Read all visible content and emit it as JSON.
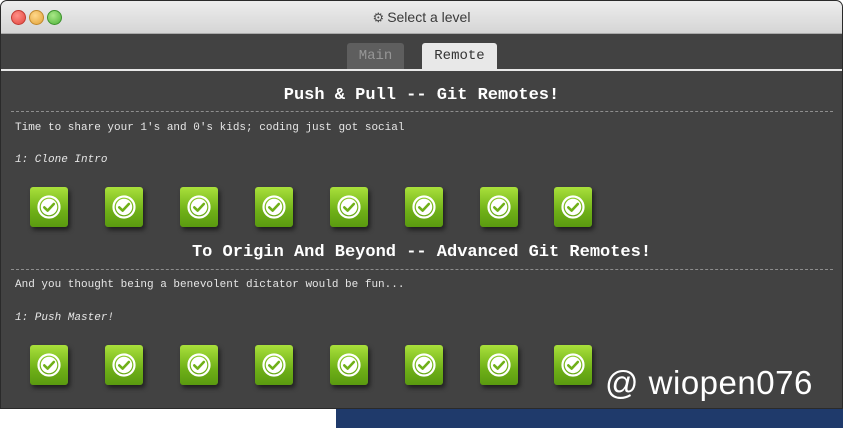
{
  "window": {
    "title": "Select a level",
    "title_icon": "gear-icon"
  },
  "tabs": [
    {
      "label": "Main",
      "active": false
    },
    {
      "label": "Remote",
      "active": true
    }
  ],
  "sections": [
    {
      "title": "Push & Pull -- Git Remotes!",
      "description": "Time to share your 1's and 0's kids; coding just got social",
      "sequence_label": "1: Clone Intro",
      "levels": [
        {
          "status": "completed",
          "icon": "checkmark-icon"
        },
        {
          "status": "completed",
          "icon": "checkmark-icon"
        },
        {
          "status": "completed",
          "icon": "checkmark-icon"
        },
        {
          "status": "completed",
          "icon": "checkmark-icon"
        },
        {
          "status": "completed",
          "icon": "checkmark-icon"
        },
        {
          "status": "completed",
          "icon": "checkmark-icon"
        },
        {
          "status": "completed",
          "icon": "checkmark-icon"
        },
        {
          "status": "completed",
          "icon": "checkmark-icon"
        }
      ]
    },
    {
      "title": "To Origin And Beyond -- Advanced Git Remotes!",
      "description": "And you thought being a benevolent dictator would be fun...",
      "sequence_label": "1: Push Master!",
      "levels": [
        {
          "status": "completed",
          "icon": "checkmark-icon"
        },
        {
          "status": "completed",
          "icon": "checkmark-icon"
        },
        {
          "status": "completed",
          "icon": "checkmark-icon"
        },
        {
          "status": "completed",
          "icon": "checkmark-icon"
        },
        {
          "status": "completed",
          "icon": "checkmark-icon"
        },
        {
          "status": "completed",
          "icon": "checkmark-icon"
        },
        {
          "status": "completed",
          "icon": "checkmark-icon"
        },
        {
          "status": "completed",
          "icon": "checkmark-icon"
        }
      ]
    }
  ],
  "watermark": "@ wiopen076",
  "colors": {
    "window_bg": "#424242",
    "level_complete_green": "#6fb018",
    "active_tab_bg": "#e8e8e8"
  }
}
